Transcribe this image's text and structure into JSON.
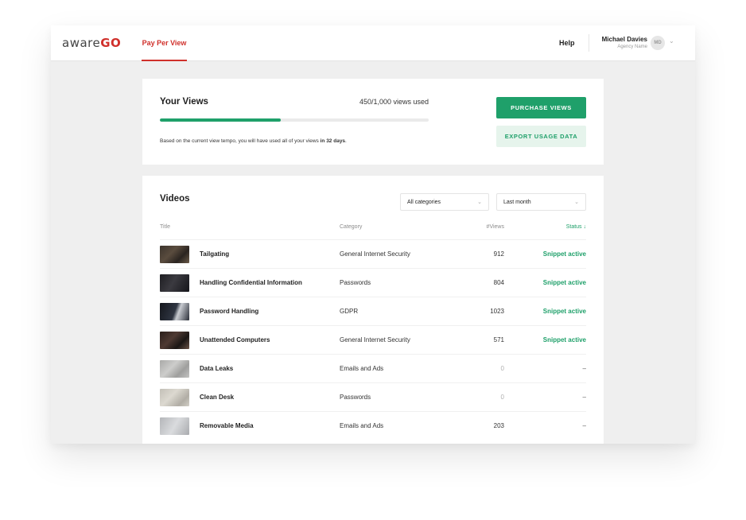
{
  "brand": {
    "logo_light": "aware",
    "logo_bold": "GO"
  },
  "nav": {
    "active_tab": "Pay Per View",
    "help": "Help"
  },
  "user": {
    "name": "Michael Davies",
    "agency": "Agency Name",
    "initials": "MD"
  },
  "views": {
    "title": "Your Views",
    "used_text": "450/1,000 views used",
    "used": 450,
    "total": 1000,
    "note_prefix": "Based on the current view tempo, you will have used all of your views ",
    "note_bold": "in 32 days",
    "note_suffix": ".",
    "purchase_label": "PURCHASE VIEWS",
    "export_label": "EXPORT USAGE DATA"
  },
  "videos": {
    "title": "Videos",
    "category_filter": "All categories",
    "time_filter": "Last month",
    "columns": {
      "title": "Title",
      "category": "Category",
      "views": "#Views",
      "status": "Status ↓"
    },
    "rows": [
      {
        "title": "Tailgating",
        "category": "General Internet Security",
        "views": "912",
        "status": "Snippet active",
        "thumb": "dark"
      },
      {
        "title": "Handling Confidential Information",
        "category": "Passwords",
        "views": "804",
        "status": "Snippet active",
        "thumb": "dark2"
      },
      {
        "title": "Password Handling",
        "category": "GDPR",
        "views": "1023",
        "status": "Snippet active",
        "thumb": "dark3"
      },
      {
        "title": "Unattended Computers",
        "category": "General Internet Security",
        "views": "571",
        "status": "Snippet active",
        "thumb": "dark4"
      },
      {
        "title": "Data Leaks",
        "category": "Emails and Ads",
        "views": "0",
        "status": "–",
        "thumb": "light"
      },
      {
        "title": "Clean Desk",
        "category": "Passwords",
        "views": "0",
        "status": "–",
        "thumb": "light2"
      },
      {
        "title": "Removable Media",
        "category": "Emails and Ads",
        "views": "203",
        "status": "–",
        "thumb": "light3"
      }
    ]
  },
  "colors": {
    "brand_red": "#d0302b",
    "accent_green": "#1fa06a",
    "background": "#efefef"
  },
  "icons": {
    "user_menu": "chevron-down-icon",
    "select_caret": "chevron-down-icon",
    "sort": "arrow-down-icon"
  }
}
